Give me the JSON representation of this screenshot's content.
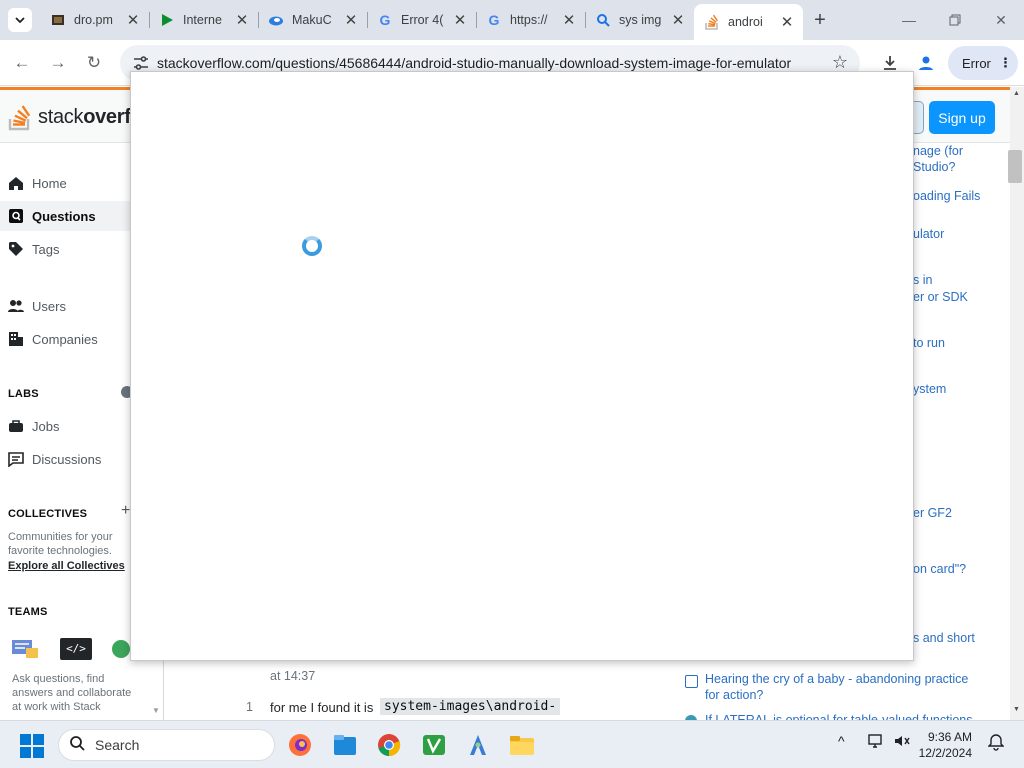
{
  "browser": {
    "tabs": [
      {
        "title": "dro.pm",
        "icon": "film-icon",
        "active": false
      },
      {
        "title": "Interne",
        "icon": "play-icon",
        "active": false
      },
      {
        "title": "MakuC",
        "icon": "cloud-icon",
        "active": false
      },
      {
        "title": "Error 4(",
        "icon": "google-icon",
        "active": false
      },
      {
        "title": "https://",
        "icon": "google-icon",
        "active": false
      },
      {
        "title": "sys img",
        "icon": "search-icon",
        "active": false
      },
      {
        "title": "androi",
        "icon": "stackoverflow-icon",
        "active": true
      }
    ],
    "url": "stackoverflow.com/questions/45686444/android-studio-manually-download-system-image-for-emulator",
    "error_button": "Error"
  },
  "so": {
    "logo_text_light": "stack",
    "logo_text_bold": "overfl",
    "signup": "Sign up",
    "nav": {
      "home": "Home",
      "questions": "Questions",
      "tags": "Tags",
      "users": "Users",
      "companies": "Companies",
      "labs": "LABS",
      "jobs": "Jobs",
      "discussions": "Discussions",
      "collectives": "COLLECTIVES",
      "collectives_desc_1": "Communities for your",
      "collectives_desc_2": "favorite technologies.",
      "explore_collectives": "Explore all Collectives",
      "teams": "TEAMS",
      "teams_desc_1": "Ask questions, find",
      "teams_desc_2": "answers and collaborate",
      "teams_desc_3": "at work with Stack"
    },
    "right_links": [
      "nage (for",
      "Studio?",
      "oading Fails",
      "ulator",
      "s in",
      "er or SDK",
      "to run",
      "ystem",
      "er GF2",
      "on card\"?",
      "s and short",
      "Hearing the cry of a baby - abandoning practice",
      "for action?",
      "If LATERAL is optional for table-valued functions"
    ],
    "comment_time": "at 14:37",
    "comment_score": "1",
    "comment_text": "for me I found it is",
    "comment_code": "system-images\\android-"
  },
  "taskbar": {
    "search_placeholder": "Search",
    "time": "9:36 AM",
    "date": "12/2/2024"
  }
}
